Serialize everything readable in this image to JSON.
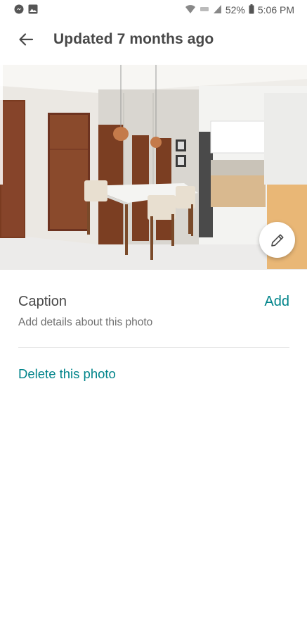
{
  "status_bar": {
    "battery": "52%",
    "time": "5:06 PM",
    "icons": [
      "messenger-icon",
      "gallery-icon",
      "wifi-icon",
      "signal-icon",
      "battery-icon"
    ]
  },
  "header": {
    "back_icon": "arrow-left-icon",
    "title": "Updated 7 months ago"
  },
  "photo": {
    "description_icon": "photo",
    "edit_icon": "pencil-icon"
  },
  "caption": {
    "label": "Caption",
    "action": "Add",
    "hint": "Add details about this photo"
  },
  "actions": {
    "delete": "Delete this photo"
  },
  "colors": {
    "accent": "#00848a",
    "text": "#484848",
    "muted": "#6f6f6f"
  }
}
